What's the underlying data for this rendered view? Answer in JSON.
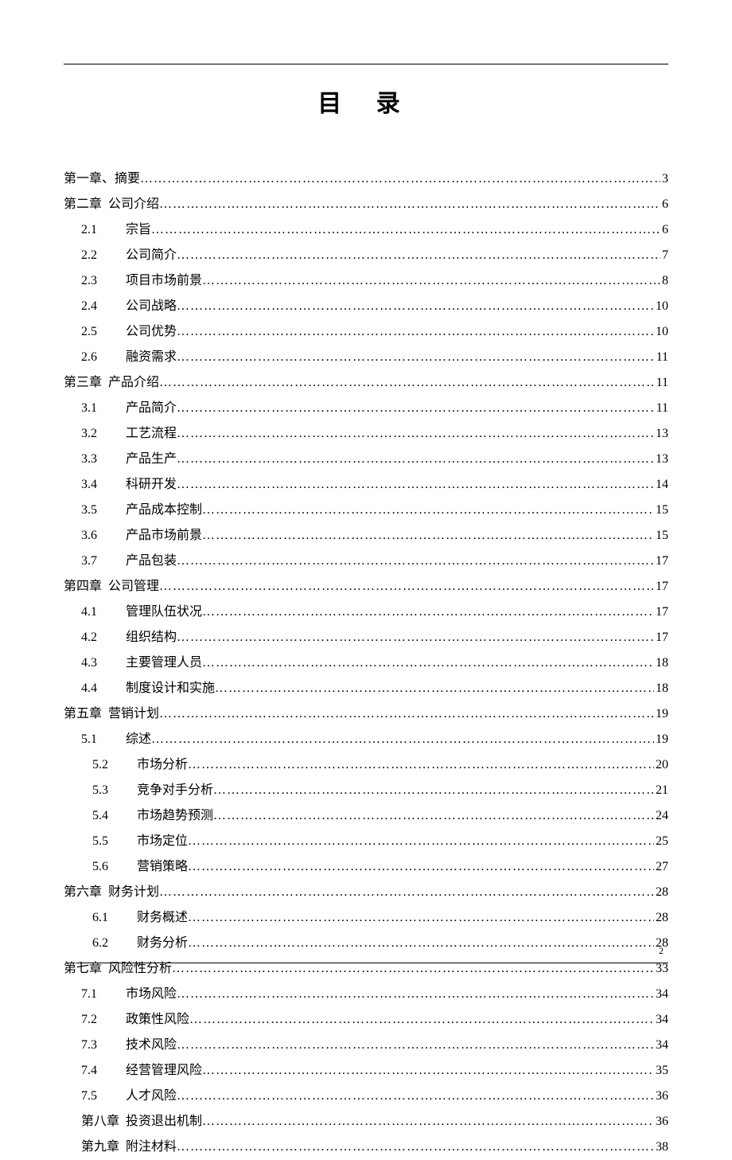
{
  "title": "目 录",
  "page_number": "2",
  "toc": [
    {
      "indent": 0,
      "num": "第一章、",
      "label": "摘要",
      "page": "3"
    },
    {
      "indent": 0,
      "num": "第二章",
      "label": "公司介绍",
      "page": "6"
    },
    {
      "indent": 1,
      "num": "2.1",
      "label": "宗旨",
      "page": "6"
    },
    {
      "indent": 1,
      "num": "2.2",
      "label": "公司简介",
      "page": "7"
    },
    {
      "indent": 1,
      "num": "2.3",
      "label": "项目市场前景",
      "page": "8"
    },
    {
      "indent": 1,
      "num": "2.4",
      "label": "公司战略",
      "page": "10"
    },
    {
      "indent": 1,
      "num": "2.5",
      "label": "公司优势",
      "page": "10"
    },
    {
      "indent": 1,
      "num": "2.6",
      "label": "融资需求",
      "page": "11"
    },
    {
      "indent": 0,
      "num": "第三章",
      "label": "产品介绍",
      "page": "11"
    },
    {
      "indent": 1,
      "num": "3.1",
      "label": "产品简介",
      "page": "11"
    },
    {
      "indent": 1,
      "num": "3.2",
      "label": "工艺流程",
      "page": "13"
    },
    {
      "indent": 1,
      "num": "3.3",
      "label": "产品生产",
      "page": "13"
    },
    {
      "indent": 1,
      "num": "3.4",
      "label": "科研开发",
      "page": "14"
    },
    {
      "indent": 1,
      "num": "3.5",
      "label": "产品成本控制",
      "page": "15"
    },
    {
      "indent": 1,
      "num": "3.6",
      "label": "产品市场前景",
      "page": "15"
    },
    {
      "indent": 1,
      "num": "3.7",
      "label": "产品包装",
      "page": "17"
    },
    {
      "indent": 0,
      "num": "第四章",
      "label": "公司管理",
      "page": "17"
    },
    {
      "indent": 1,
      "num": "4.1",
      "label": "管理队伍状况",
      "page": "17"
    },
    {
      "indent": 1,
      "num": "4.2",
      "label": "组织结构",
      "page": "17"
    },
    {
      "indent": 1,
      "num": "4.3",
      "label": "主要管理人员",
      "page": "18"
    },
    {
      "indent": 1,
      "num": "4.4",
      "label": "制度设计和实施",
      "page": "18"
    },
    {
      "indent": 0,
      "num": "第五章",
      "label": "营销计划",
      "page": "19"
    },
    {
      "indent": 1,
      "num": "5.1",
      "label": "综述",
      "page": "19"
    },
    {
      "indent": 2,
      "num": "5.2",
      "label": "市场分析",
      "page": "20"
    },
    {
      "indent": 2,
      "num": "5.3",
      "label": "竞争对手分析",
      "page": "21"
    },
    {
      "indent": 2,
      "num": "5.4",
      "label": "市场趋势预测",
      "page": "24"
    },
    {
      "indent": 2,
      "num": "5.5",
      "label": "市场定位",
      "page": "25"
    },
    {
      "indent": 2,
      "num": "5.6",
      "label": "营销策略",
      "page": "27"
    },
    {
      "indent": 0,
      "num": "第六章",
      "label": "财务计划",
      "page": "28"
    },
    {
      "indent": 2,
      "num": "6.1",
      "label": "财务概述",
      "page": "28"
    },
    {
      "indent": 2,
      "num": "6.2",
      "label": "财务分析",
      "page": "28"
    },
    {
      "indent": 0,
      "num": "第七章",
      "label": "风险性分析",
      "page": "33"
    },
    {
      "indent": 1,
      "num": "7.1",
      "label": "市场风险",
      "page": "34"
    },
    {
      "indent": 1,
      "num": "7.2",
      "label": "政策性风险",
      "page": "34"
    },
    {
      "indent": 1,
      "num": "7.3",
      "label": "技术风险",
      "page": "34"
    },
    {
      "indent": 1,
      "num": "7.4",
      "label": "经营管理风险",
      "page": "35"
    },
    {
      "indent": 1,
      "num": "7.5",
      "label": "人才风险",
      "page": "36"
    },
    {
      "indent": 1,
      "num": "第八章",
      "label": "投资退出机制",
      "page": "36"
    },
    {
      "indent": 1,
      "num": "第九章",
      "label": "附注材料",
      "page": "38"
    }
  ]
}
